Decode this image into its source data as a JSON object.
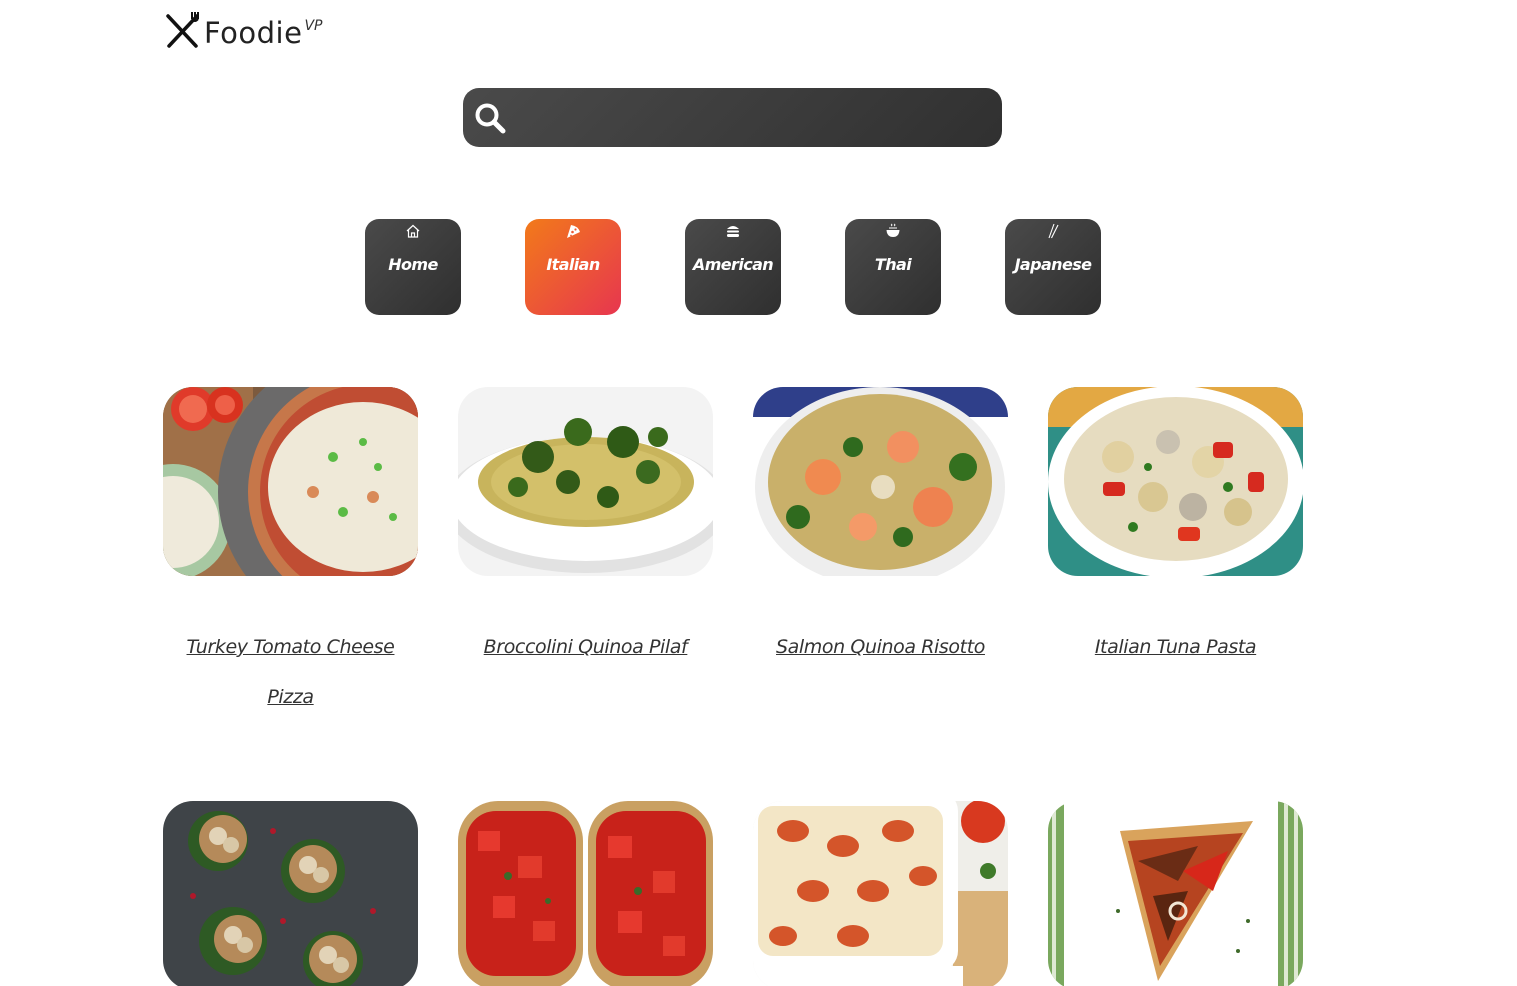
{
  "brand": {
    "name": "Foodie",
    "suffix": "VP"
  },
  "search": {
    "placeholder": "",
    "value": ""
  },
  "categories": [
    {
      "label": "Home",
      "icon": "home-icon"
    },
    {
      "label": "Italian",
      "icon": "pizza-icon",
      "active": true
    },
    {
      "label": "American",
      "icon": "burger-icon"
    },
    {
      "label": "Thai",
      "icon": "noodle-bowl-icon"
    },
    {
      "label": "Japanese",
      "icon": "chopsticks-icon"
    }
  ],
  "recipes": [
    {
      "title": "Turkey Tomato Cheese Pizza"
    },
    {
      "title": "Broccolini Quinoa Pilaf"
    },
    {
      "title": "Salmon Quinoa Risotto"
    },
    {
      "title": "Italian Tuna Pasta"
    }
  ],
  "colors": {
    "active_start": "#f27a1a",
    "active_end": "#e7364f",
    "dark": "#3a3a3a"
  }
}
